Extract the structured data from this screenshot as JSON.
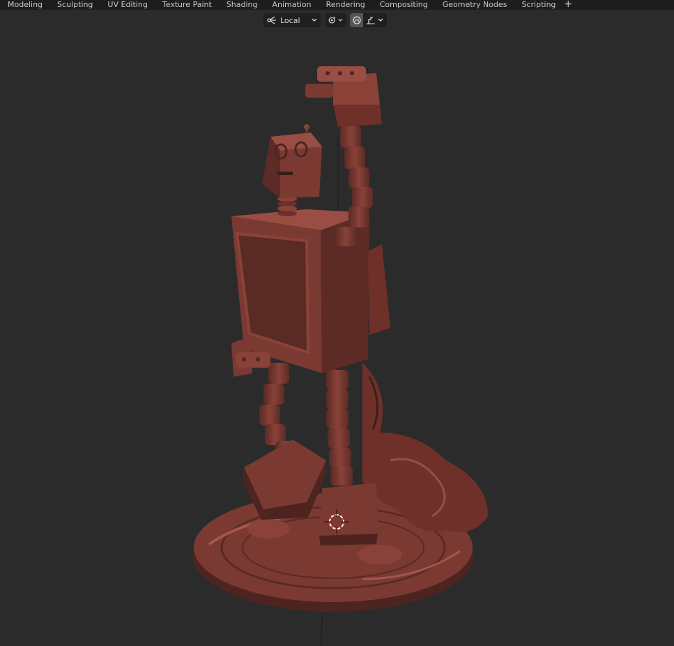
{
  "workspace_tabs": [
    "Modeling",
    "Sculpting",
    "UV Editing",
    "Texture Paint",
    "Shading",
    "Animation",
    "Rendering",
    "Compositing",
    "Geometry Nodes",
    "Scripting"
  ],
  "add_tab_label": "+",
  "viewport_header": {
    "pivot_point_label": "Local",
    "pivot_icon": "pivot-point-icon",
    "snap_icon": "snap-magnet-icon",
    "proportional_icon": "proportional-editing-icon",
    "falloff_icon": "falloff-curve-icon"
  },
  "colors": {
    "background": "#2b2b2b",
    "topbar": "#1d1d1d",
    "model_base": "#7a3a32",
    "model_shadow": "#4e2420",
    "model_highlight": "#a5574c",
    "cursor_red": "#e03a3a"
  },
  "scene_objects": {
    "model_name": "robot-sculpt",
    "cursor_icon": "3d-cursor-icon"
  }
}
